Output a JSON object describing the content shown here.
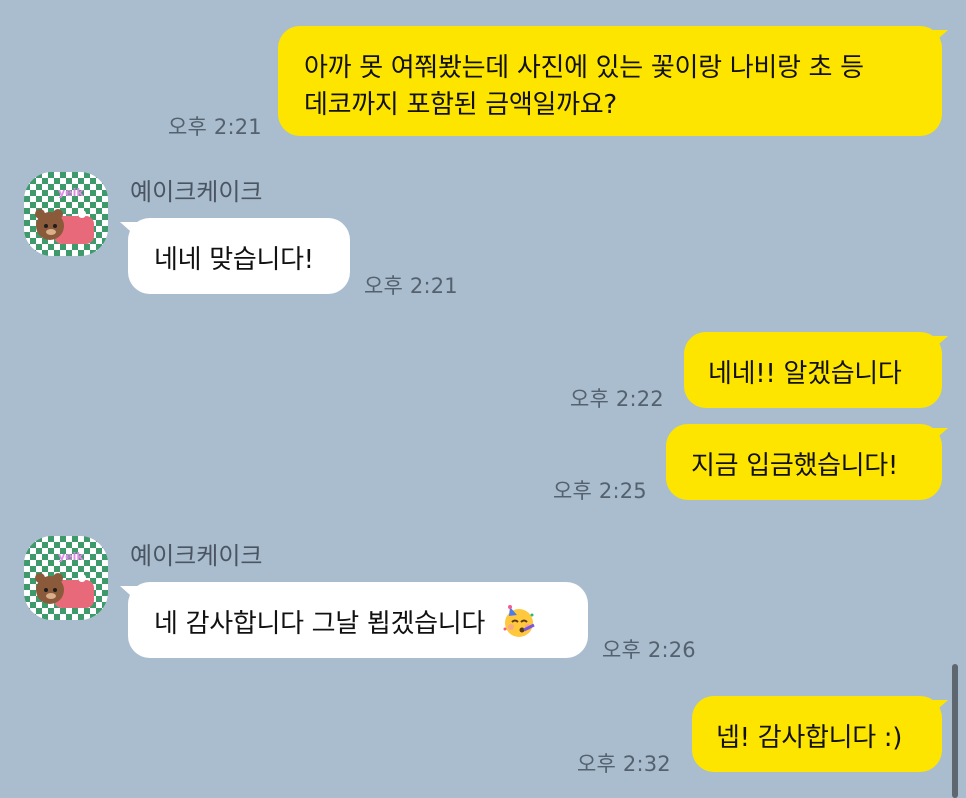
{
  "messages": [
    {
      "from": "me",
      "lines": [
        "아까 못 여쭤봤는데 사진에 있는 꽃이랑 나비랑 초 등",
        "데코까지 포함된 금액일까요?"
      ],
      "time": "오후 2:21"
    },
    {
      "from": "shop",
      "sender": "예이크케이크",
      "text": "네네 맞습니다!",
      "time": "오후 2:21"
    },
    {
      "from": "me",
      "text": "네네!! 알겠습니다",
      "time": "오후 2:22"
    },
    {
      "from": "me",
      "text": "지금 입금했습니다!",
      "time": "오후 2:25"
    },
    {
      "from": "shop",
      "sender": "예이크케이크",
      "text": "네 감사합니다 그날 뵙겠습니다",
      "emoji": "partying-face-icon",
      "time": "오후 2:26"
    },
    {
      "from": "me",
      "text": "넵! 감사합니다 :)",
      "time": "오후 2:32"
    }
  ],
  "avatar": {
    "text": "yeik",
    "icon": "bear-cake-avatar-icon"
  },
  "colors": {
    "background": "#A9BDCE",
    "my_bubble": "#FEE500",
    "their_bubble": "#FFFFFF",
    "checker_green": "#3E9A6B"
  }
}
